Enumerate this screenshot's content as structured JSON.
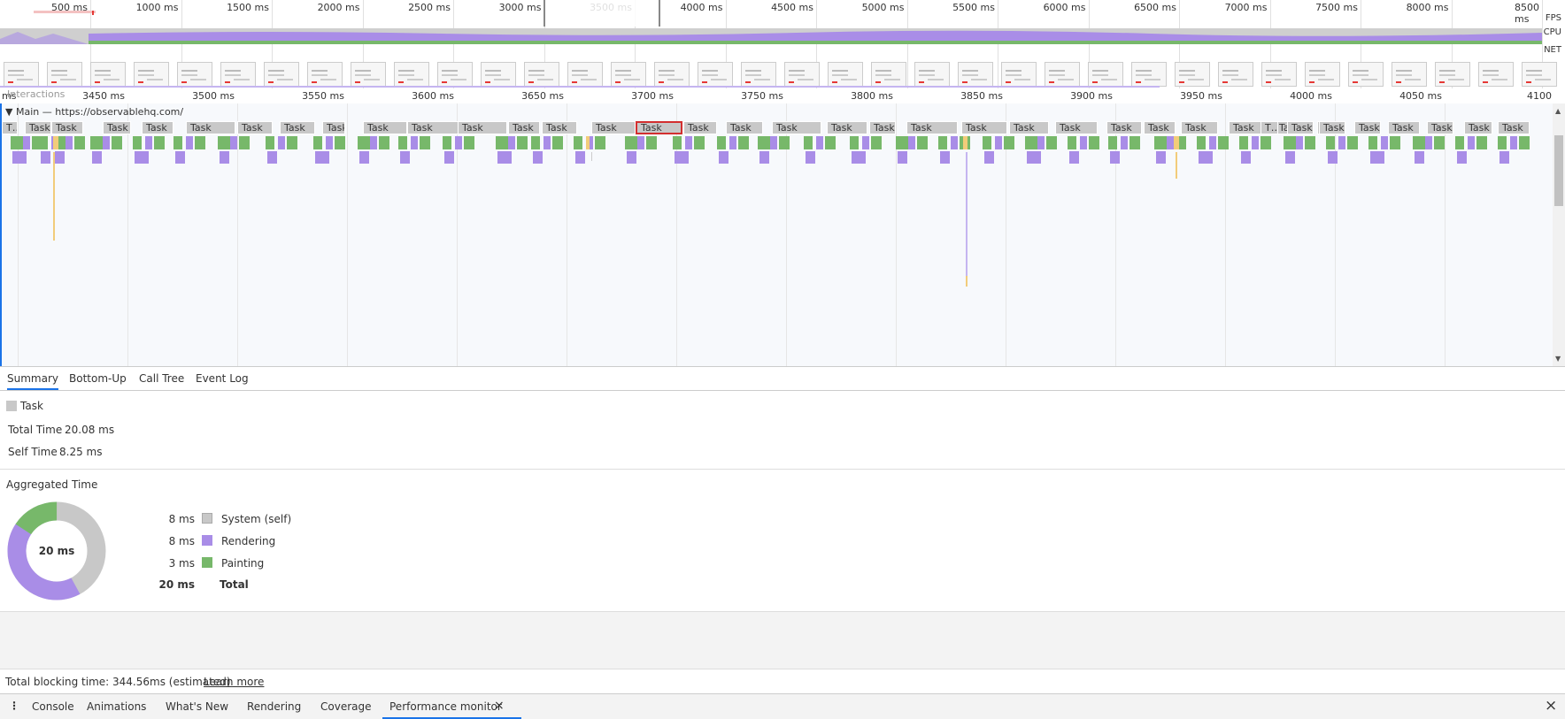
{
  "overview": {
    "ticks": [
      "500 ms",
      "1000 ms",
      "1500 ms",
      "2000 ms",
      "2500 ms",
      "3000 ms",
      "3500 ms",
      "4000 ms",
      "4500 ms",
      "5000 ms",
      "5500 ms",
      "6000 ms",
      "6500 ms",
      "7000 ms",
      "7500 ms",
      "8000 ms",
      "8500 ms"
    ],
    "fps_label": "FPS",
    "cpu_label": "CPU",
    "net_label": "NET"
  },
  "timeline": {
    "interactions_label": "Interactions",
    "ticks": [
      "3450 ms",
      "3500 ms",
      "3550 ms",
      "3600 ms",
      "3650 ms",
      "3700 ms",
      "3750 ms",
      "3800 ms",
      "3850 ms",
      "3900 ms",
      "3950 ms",
      "4000 ms",
      "4050 ms",
      "4100 ms"
    ],
    "main_thread_label": "Main — https://observablehq.com/",
    "task_label": "Task",
    "task_short": "T…",
    "task_short_k": "T…k"
  },
  "tabs": [
    "Summary",
    "Bottom-Up",
    "Call Tree",
    "Event Log"
  ],
  "summary": {
    "title": "Task",
    "total_time_label": "Total Time",
    "total_time_value": "20.08 ms",
    "self_time_label": "Self Time",
    "self_time_value": "8.25 ms",
    "aggregated_title": "Aggregated Time",
    "donut_center": "20 ms",
    "rows": [
      {
        "value": "8 ms",
        "label": "System (self)",
        "color": "#c8c8c8"
      },
      {
        "value": "8 ms",
        "label": "Rendering",
        "color": "#a98de7"
      },
      {
        "value": "3 ms",
        "label": "Painting",
        "color": "#77b86a"
      }
    ],
    "total_value": "20 ms",
    "total_label": "Total"
  },
  "status": {
    "text": "Total blocking time: 344.56ms (estimated)",
    "link": "Learn more"
  },
  "drawer": {
    "tabs": [
      "Console",
      "Animations",
      "What's New",
      "Rendering",
      "Coverage",
      "Performance monitor"
    ],
    "close_tab_icon": "×",
    "close_drawer_icon": "×",
    "menu_icon": "⋮"
  },
  "colors": {
    "system": "#c8c8c8",
    "rendering": "#a98de7",
    "painting": "#77b86a",
    "scripting": "#f2cc7a",
    "selection": "#d32f2f",
    "accent": "#1a73e8"
  }
}
